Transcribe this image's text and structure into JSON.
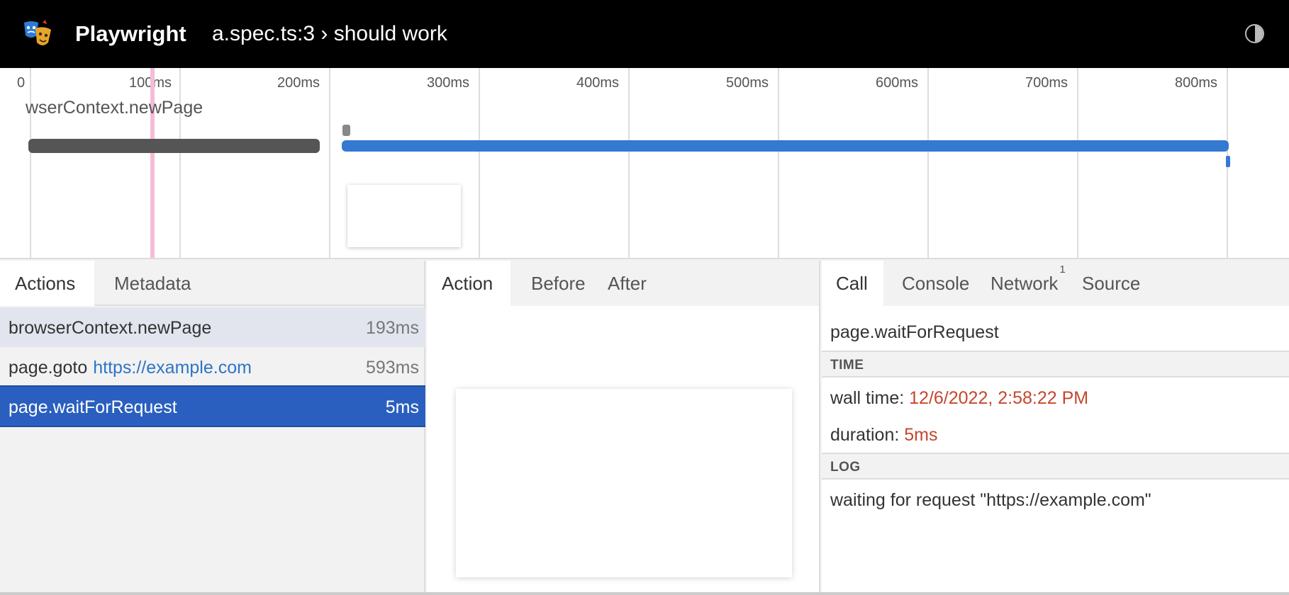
{
  "header": {
    "brand": "Playwright",
    "title": "a.spec.ts:3 › should work",
    "logo_icon": "playwright-masks-icon",
    "theme_icon": "contrast-toggle-icon"
  },
  "timeline": {
    "ticks": [
      "0",
      "100ms",
      "200ms",
      "300ms",
      "400ms",
      "500ms",
      "600ms",
      "700ms",
      "800ms"
    ],
    "action_label": "wserContext.newPage",
    "colors": {
      "bar_gray": "#555555",
      "bar_blue": "#3479d2",
      "cursor": "#f5bcd6"
    }
  },
  "left_tabs": {
    "actions": "Actions",
    "metadata": "Metadata"
  },
  "actions": [
    {
      "name": "browserContext.newPage",
      "url": "",
      "duration": "193ms",
      "state": "hover"
    },
    {
      "name": "page.goto",
      "url": "https://example.com",
      "duration": "593ms",
      "state": "normal"
    },
    {
      "name": "page.waitForRequest",
      "url": "",
      "duration": "5ms",
      "state": "selected"
    }
  ],
  "snapshot_tabs": {
    "action": "Action",
    "before": "Before",
    "after": "After"
  },
  "details_tabs": {
    "call": "Call",
    "console": "Console",
    "network": "Network",
    "network_badge": "1",
    "source": "Source"
  },
  "call": {
    "title": "page.waitForRequest",
    "time_header": "TIME",
    "wall_time_label": "wall time:",
    "wall_time_value": "12/6/2022, 2:58:22 PM",
    "duration_label": "duration:",
    "duration_value": "5ms",
    "log_header": "LOG",
    "log_line": "waiting for request \"https://example.com\""
  }
}
